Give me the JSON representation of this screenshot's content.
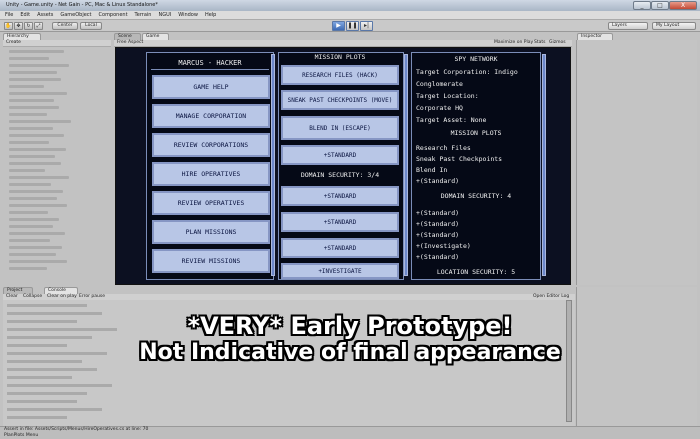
{
  "window": {
    "title": "Unity - Game.unity - Net Gain - PC, Mac & Linux Standalone*",
    "controls": [
      "_",
      "□",
      "X"
    ]
  },
  "menu": [
    "File",
    "Edit",
    "Assets",
    "GameObject",
    "Component",
    "Terrain",
    "NGUI",
    "Window",
    "Help"
  ],
  "toolbar": {
    "center_label": "Center",
    "local_label": "Local",
    "layers_label": "Layers",
    "layout_label": "My Layout"
  },
  "hierarchy": {
    "tab": "Hierarchy",
    "create_label": "Create"
  },
  "scene_tabs": {
    "scene": "Scene",
    "game": "Game",
    "aspect": "Free Aspect",
    "maximize": "Maximize on Play",
    "stats": "Stats",
    "gizmos": "Gizmos"
  },
  "inspector": {
    "tab": "Inspector"
  },
  "game": {
    "left_title": "MARCUS - HACKER",
    "left_buttons": [
      "GAME HELP",
      "MANAGE CORPORATION",
      "REVIEW CORPORATIONS",
      "HIRE OPERATIVES",
      "REVIEW OPERATIVES",
      "PLAN MISSIONS",
      "REVIEW MISSIONS"
    ],
    "mid_title": "MISSION PLOTS",
    "mid_plots": [
      "RESEARCH FILES (HACK)",
      "SNEAK PAST CHECKPOINTS (MOVE)",
      "BLEND IN (ESCAPE)",
      "+STANDARD"
    ],
    "mid_domain": "DOMAIN SECURITY: 3/4",
    "mid_domain_items": [
      "+STANDARD",
      "+STANDARD",
      "+STANDARD",
      "+INVESTIGATE"
    ],
    "spy": {
      "title": "SPY NETWORK",
      "lines": [
        "Target Corporation: Indigo",
        "Conglomerate",
        "Target Location:",
        "Corporate HQ",
        "Target Asset: None"
      ],
      "plots_title": "MISSION PLOTS",
      "plots": [
        "Research Files",
        "Sneak Past Checkpoints",
        "Blend In",
        "+(Standard)"
      ],
      "domain_title": "DOMAIN SECURITY: 4",
      "domain_items": [
        "+(Standard)",
        "+(Standard)",
        "+(Standard)",
        "+(Investigate)",
        "+(Standard)"
      ],
      "location": "LOCATION SECURITY: 5"
    }
  },
  "bottom_tabs": {
    "project": "Project",
    "console": "Console",
    "clear": "Clear",
    "collapse": "Collapse",
    "clear_on_play": "Clear on play",
    "error_pause": "Error pause",
    "open_log": "Open Editor Log"
  },
  "overlay": {
    "line1": "*VERY* Early Prototype!",
    "line2": "Not Indicative of final appearance"
  },
  "status": {
    "message": "Assert in file: Assets/Scripts/Menus/HireOperatives.cs at line: 70",
    "sub": "PlanPlots Menu"
  }
}
